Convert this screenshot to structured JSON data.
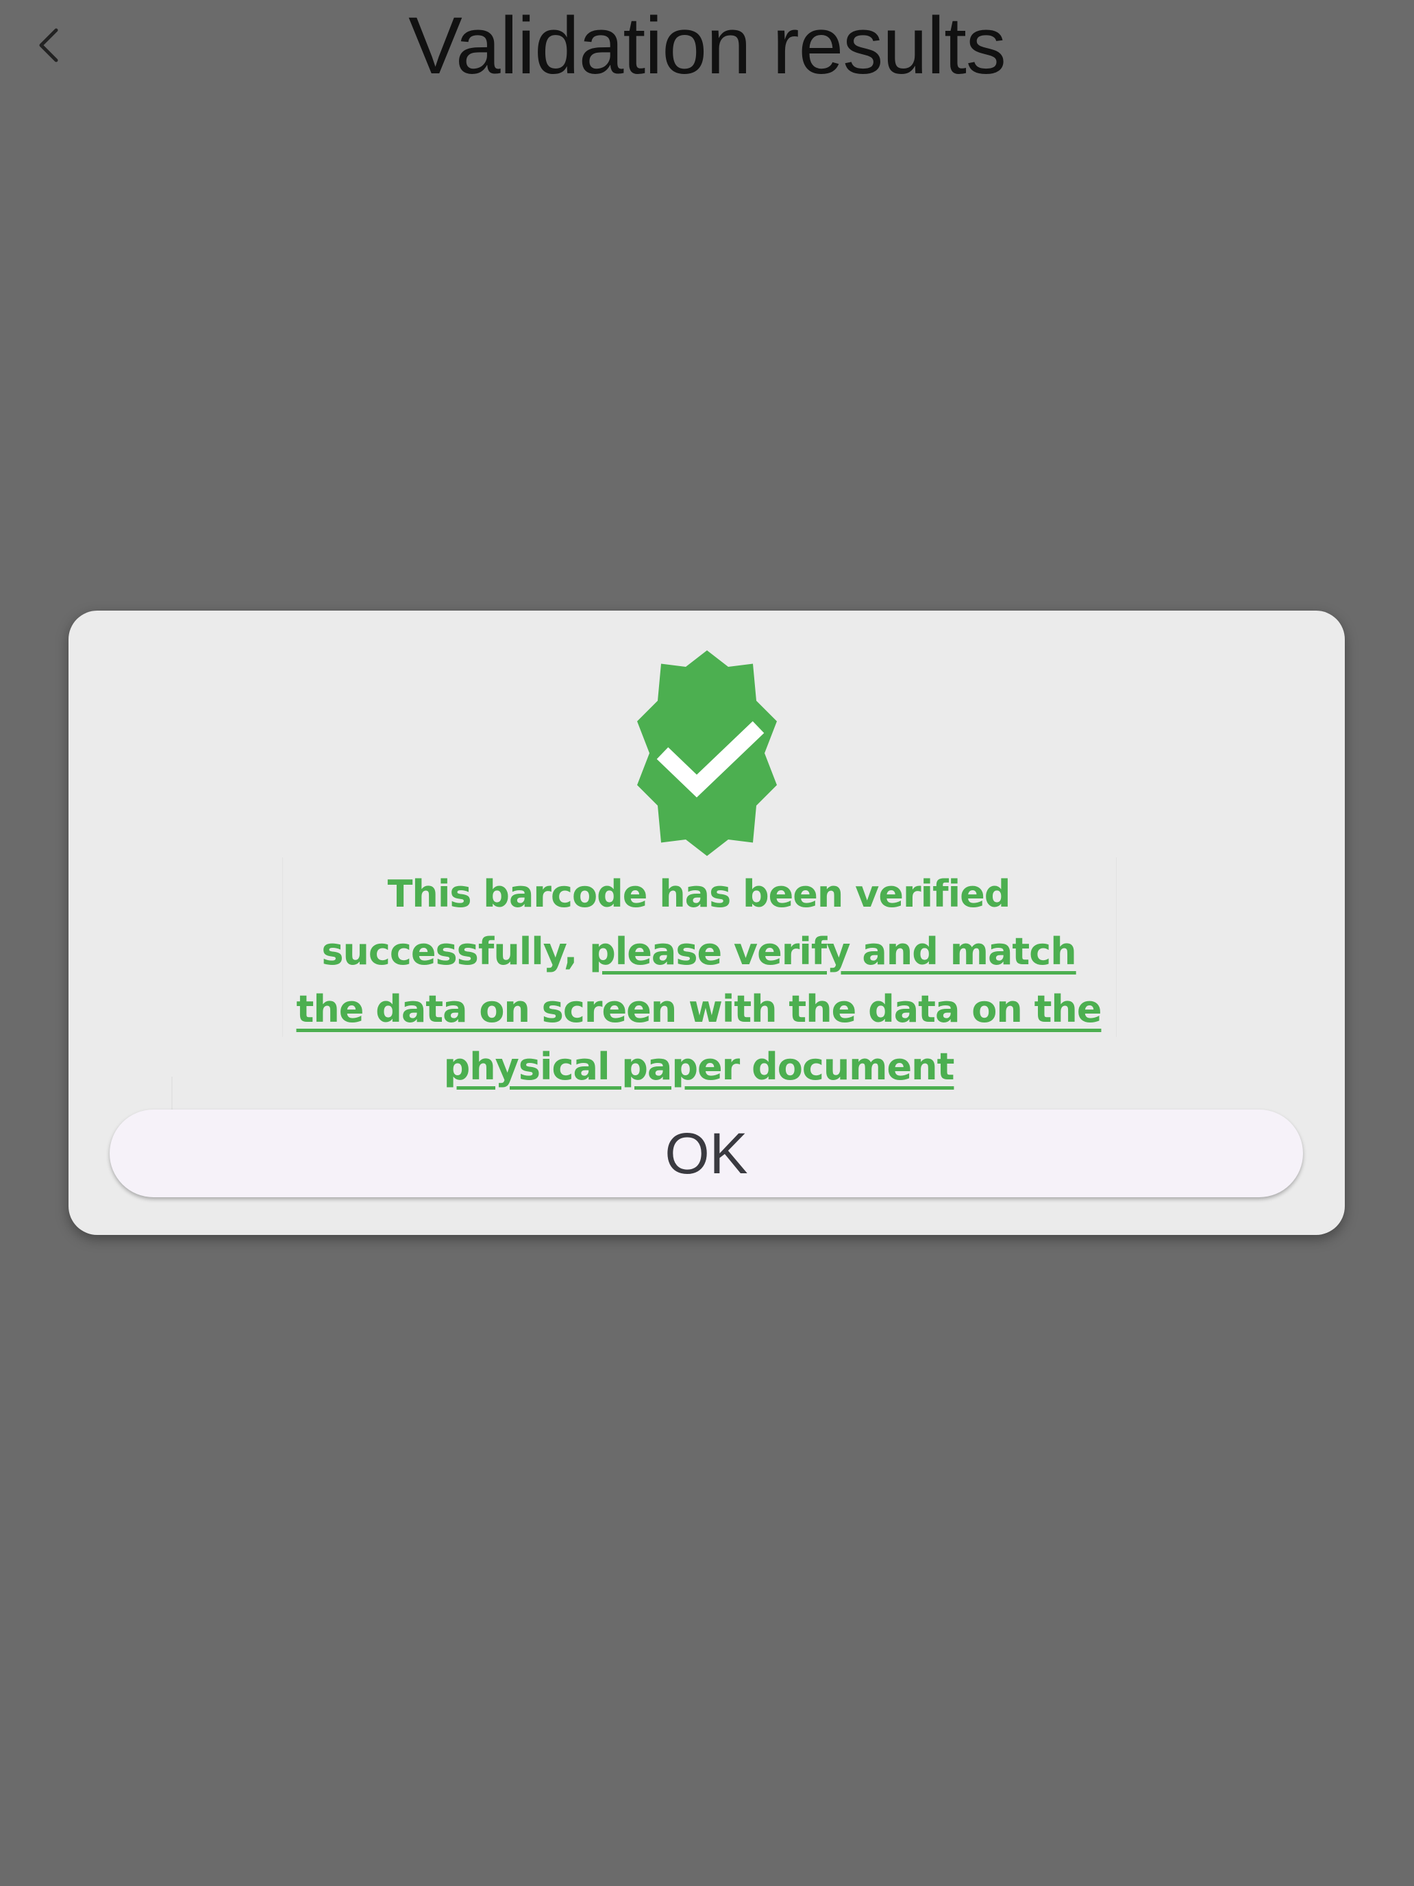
{
  "header": {
    "title": "Validation results",
    "back_icon": "chevron-left-icon"
  },
  "dialog": {
    "badge_icon": "verified-badge-icon",
    "badge_color": "#4caf50",
    "message_plain": "This barcode has been verified successfully, ",
    "message_emphasis": "please verify and match the data on screen with the data on the physical paper document",
    "ok_label": "OK"
  },
  "colors": {
    "background": "#6b6b6b",
    "dialog": "#ebebeb",
    "accent": "#4caf50",
    "button": "#f6f2f9"
  }
}
